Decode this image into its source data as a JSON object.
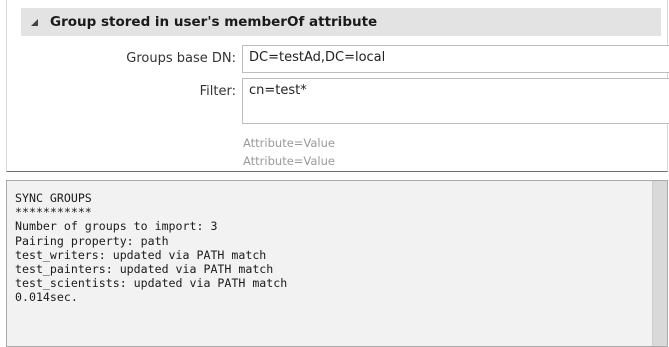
{
  "section": {
    "title": "Group stored in user's memberOf attribute"
  },
  "fields": {
    "groups_base_dn": {
      "label": "Groups base DN:",
      "value": "DC=testAd,DC=local"
    },
    "filter": {
      "label": "Filter:",
      "value": "cn=test*"
    },
    "hints": [
      "Attribute=Value",
      "Attribute=Value"
    ]
  },
  "console": {
    "lines": [
      "SYNC GROUPS",
      "***********",
      "Number of groups to import: 3",
      "Pairing property: path",
      "test_writers: updated via PATH match",
      "test_painters: updated via PATH match",
      "test_scientists: updated via PATH match",
      "0.014sec."
    ]
  }
}
